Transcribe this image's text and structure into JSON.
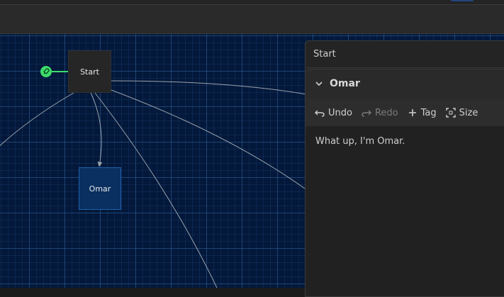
{
  "canvas": {
    "nodes": [
      {
        "id": "start",
        "label": "Start"
      },
      {
        "id": "omar",
        "label": "Omar"
      }
    ]
  },
  "panel": {
    "title": "Start",
    "card": {
      "title": "Omar",
      "actions": {
        "undo": "Undo",
        "redo": "Redo",
        "tag": "Tag",
        "size": "Size"
      },
      "text": "What up, I'm Omar."
    }
  },
  "colors": {
    "canvas_bg": "#03183a",
    "entry_green": "#3ddc6b",
    "selected_node": "#0a3061",
    "panel_bg": "#242424"
  }
}
